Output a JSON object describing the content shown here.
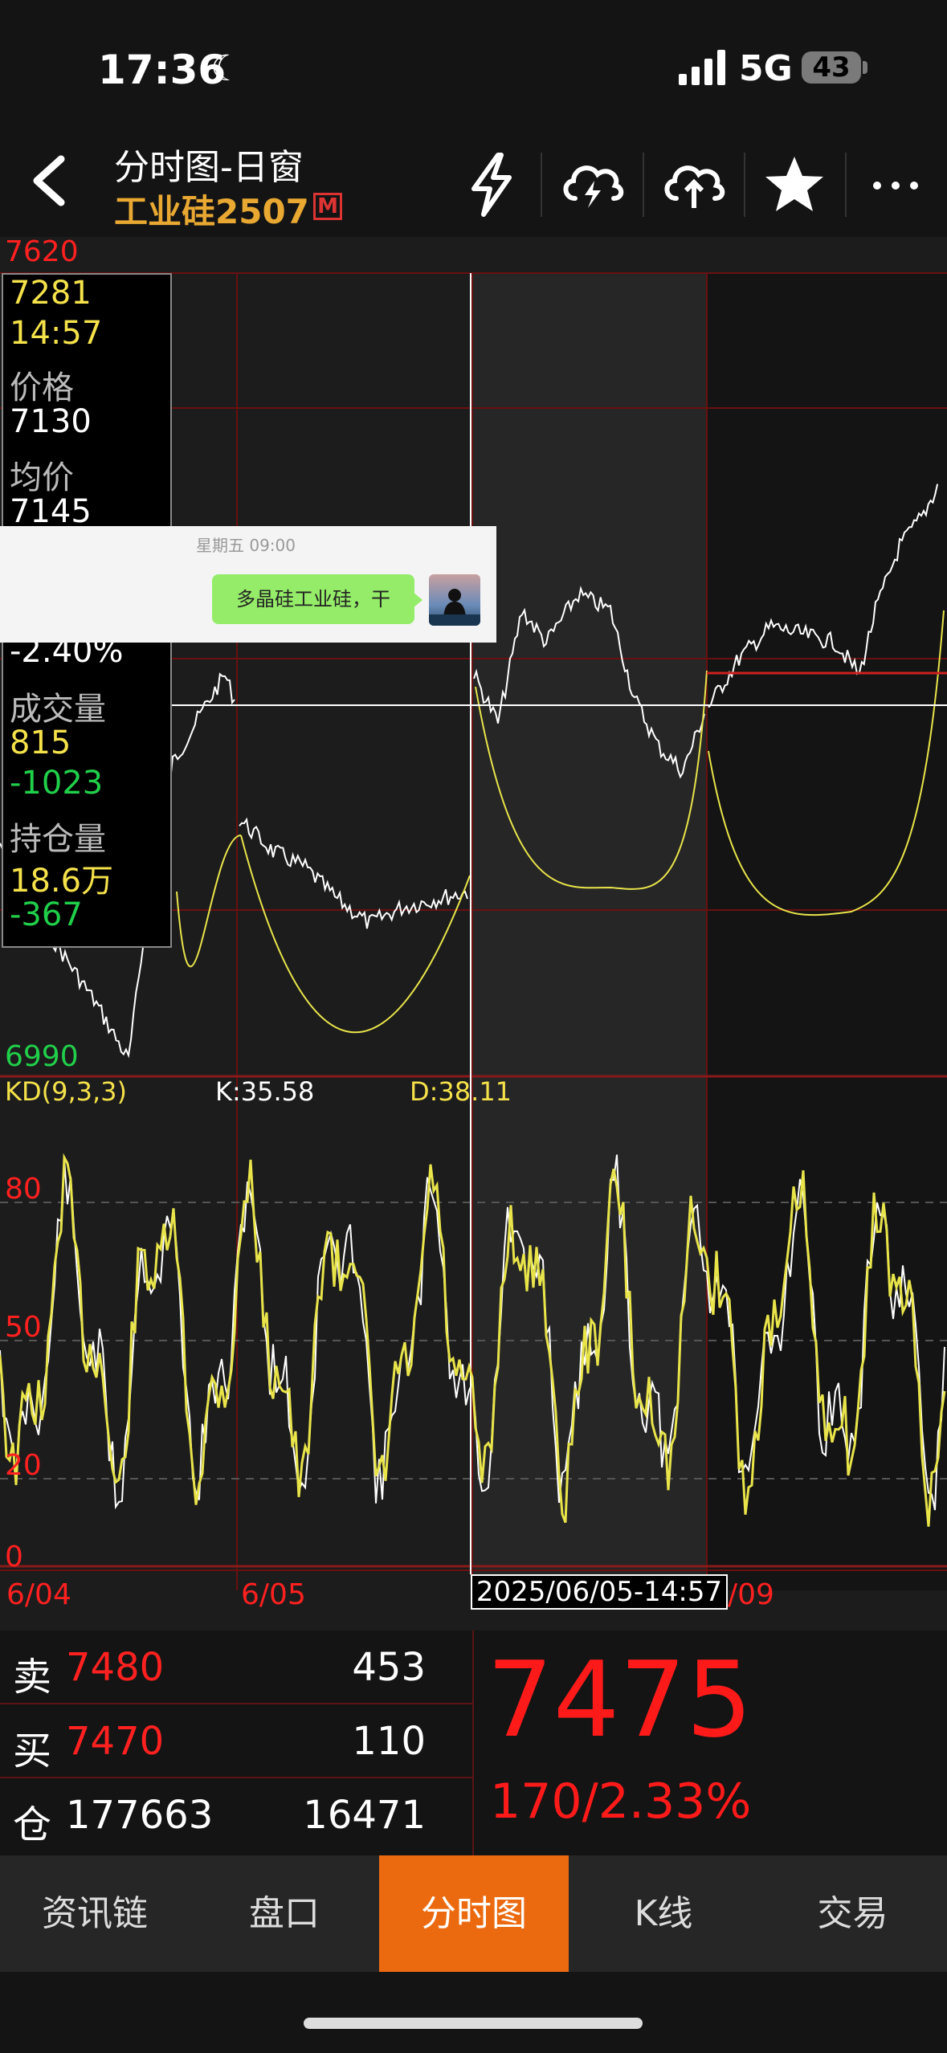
{
  "status": {
    "time": "17:36",
    "network": "5G",
    "battery": "43"
  },
  "nav": {
    "title": "分时图-日窗",
    "subtitle": "工业硅2507",
    "badge": "M"
  },
  "axis": {
    "top": "7620",
    "bottom": "6990"
  },
  "info": {
    "value": "7281",
    "time": "14:57",
    "price_label": "价格",
    "price": "7130",
    "avg_label": "均价",
    "avg": "7145",
    "pct": "-2.40%",
    "vol_label": "成交量",
    "vol": "815",
    "vol_change": "-1023",
    "oi_label": "持仓量",
    "oi": "18.6万",
    "oi_change": "-367"
  },
  "chat": {
    "date": "星期五 09:00",
    "message": "多晶硅工业硅，干"
  },
  "kd": {
    "label": "KD(9,3,3)",
    "k": "K:35.58",
    "d": "D:38.11",
    "levels": [
      "80",
      "50",
      "20",
      "0"
    ]
  },
  "dates": {
    "d1": "6/04",
    "d2": "6/05",
    "cursor": "2025/06/05-14:57",
    "d3": "/09"
  },
  "quotes": {
    "sell_label": "卖",
    "sell_price": "7480",
    "sell_qty": "453",
    "buy_label": "买",
    "buy_price": "7470",
    "buy_qty": "110",
    "oi_label": "仓",
    "oi_total": "177663",
    "oi_delta": "16471",
    "last": "7475",
    "change": "170/2.33%"
  },
  "tabs": [
    "资讯链",
    "盘口",
    "分时图",
    "K线",
    "交易"
  ],
  "colors": {
    "up": "#ff2020",
    "down": "#20d04a",
    "price_line": "#ffffff",
    "avg_line": "#f5e24a",
    "active_tab": "#ec6a0f"
  }
}
